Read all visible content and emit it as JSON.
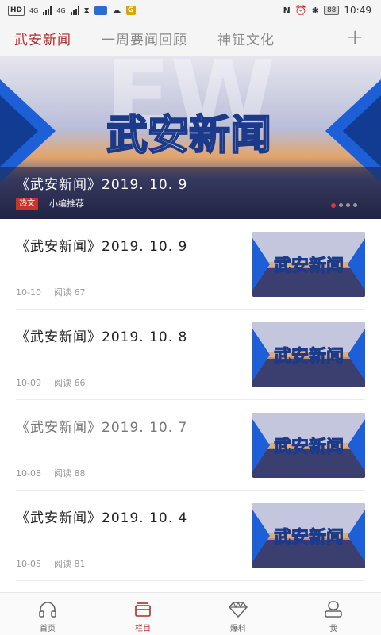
{
  "status_bar": {
    "hd_label": "HD",
    "net1": "4G",
    "net2": "4G",
    "battery": "88",
    "time": "10:49",
    "app_badge": "G"
  },
  "nav": {
    "tabs": [
      {
        "label": "武安新闻",
        "active": true
      },
      {
        "label": "一周要闻回顾",
        "active": false
      },
      {
        "label": "神钲文化",
        "active": false
      }
    ],
    "add_label": "+"
  },
  "banner": {
    "logo_text": "武安新闻",
    "title": "《武安新闻》2019. 10. 9",
    "hot_tag": "热文",
    "recommend": "小编推荐",
    "accent_color": "#c9332b"
  },
  "news": [
    {
      "title": "《武安新闻》2019. 10. 9",
      "date": "10-10",
      "reads": "阅读 67",
      "thumb_text": "武安新闻"
    },
    {
      "title": "《武安新闻》2019. 10. 8",
      "date": "10-09",
      "reads": "阅读 66",
      "thumb_text": "武安新闻"
    },
    {
      "title": "《武安新闻》2019. 10. 7",
      "date": "10-08",
      "reads": "阅读 88",
      "thumb_text": "武安新闻"
    },
    {
      "title": "《武安新闻》2019. 10. 4",
      "date": "10-05",
      "reads": "阅读 81",
      "thumb_text": "武安新闻"
    }
  ],
  "bottom_nav": [
    {
      "label": "首页",
      "icon": "headphones-icon",
      "active": false
    },
    {
      "label": "栏目",
      "icon": "columns-icon",
      "active": true
    },
    {
      "label": "爆料",
      "icon": "diamond-icon",
      "active": false
    },
    {
      "label": "我",
      "icon": "user-icon",
      "active": false
    }
  ]
}
